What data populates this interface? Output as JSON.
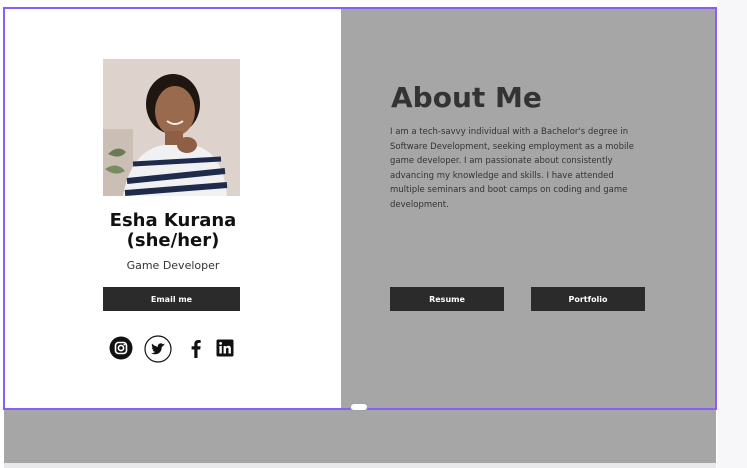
{
  "profile": {
    "name_line1": "Esha Kurana",
    "name_line2": "(she/her)",
    "role": "Game Developer",
    "email_button": "Email me"
  },
  "socials": [
    {
      "icon": "instagram-icon"
    },
    {
      "icon": "twitter-icon"
    },
    {
      "icon": "facebook-icon"
    },
    {
      "icon": "linkedin-icon"
    }
  ],
  "about": {
    "title": "About Me",
    "text": "I am a tech-savvy individual with a Bachelor's degree in Software Development, seeking employment as a mobile game developer. I am passionate about consistently advancing my knowledge and skills. I have attended multiple seminars and boot camps on coding and game development.",
    "resume_button": "Resume",
    "portfolio_button": "Portfolio"
  },
  "colors": {
    "selection_border": "#8b5cf6",
    "right_panel": "#a6a6a6",
    "button": "#2b2b2b"
  }
}
